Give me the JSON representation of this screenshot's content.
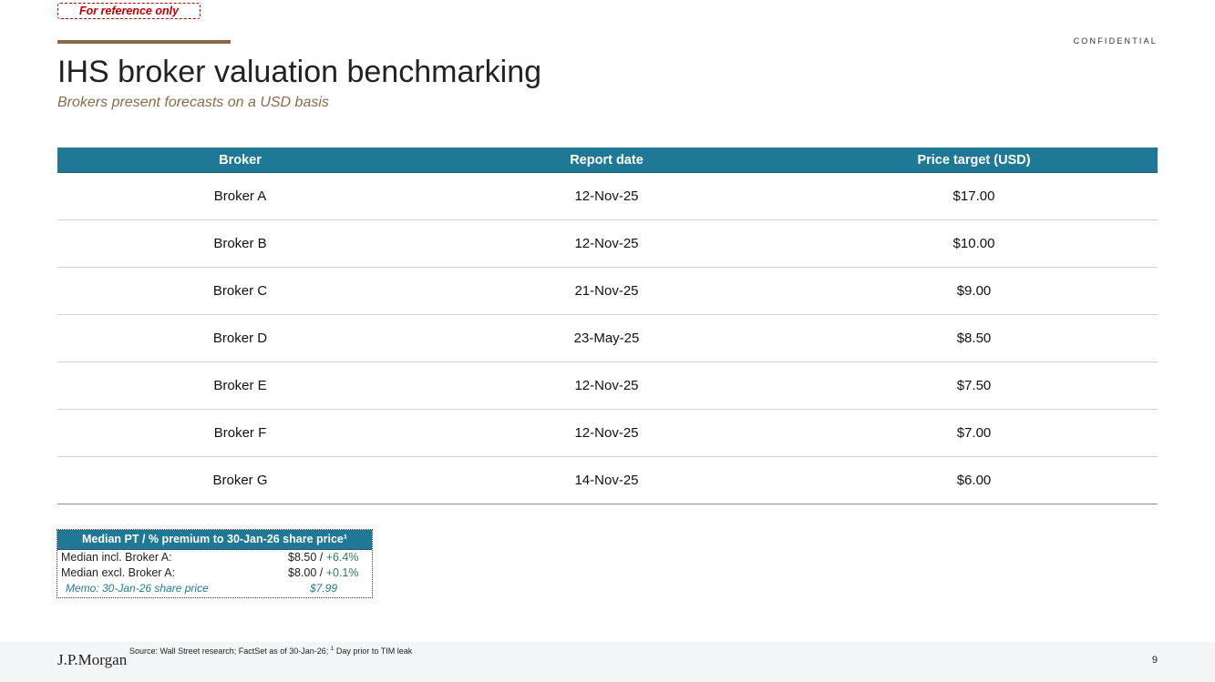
{
  "stamp": "For reference only",
  "confidential": "CONFIDENTIAL",
  "title": "IHS broker valuation benchmarking",
  "subtitle": "Brokers present forecasts on a USD basis",
  "table": {
    "headers": [
      "Broker",
      "Report date",
      "Price target (USD)"
    ],
    "rows": [
      [
        "Broker A",
        "12-Nov-25",
        "$17.00"
      ],
      [
        "Broker B",
        "12-Nov-25",
        "$10.00"
      ],
      [
        "Broker C",
        "21-Nov-25",
        "$9.00"
      ],
      [
        "Broker D",
        "23-May-25",
        "$8.50"
      ],
      [
        "Broker E",
        "12-Nov-25",
        "$7.50"
      ],
      [
        "Broker F",
        "12-Nov-25",
        "$7.00"
      ],
      [
        "Broker G",
        "14-Nov-25",
        "$6.00"
      ]
    ]
  },
  "median": {
    "header": "Median PT / % premium to 30-Jan-26 share price¹",
    "incl_label": "Median incl. Broker A:",
    "incl_value": "$8.50",
    "incl_sep": " / ",
    "incl_premium": "+6.4%",
    "excl_label": "Median excl. Broker A:",
    "excl_value": "$8.00",
    "excl_sep": " / ",
    "excl_premium": "+0.1%",
    "memo_label": "Memo: 30-Jan-26 share price",
    "memo_value": "$7.99"
  },
  "footer": {
    "source_prefix": "Source: Wall Street research; FactSet as of 30-Jan-26;",
    "footnote_mark": "1",
    "source_suffix": "Day prior to TIM leak",
    "logo": "J.P.Morgan",
    "page_number": "9"
  },
  "colors": {
    "header_blue": "#1f7896",
    "accent_brown": "#8c6a45",
    "stamp_red": "#c00000",
    "premium_green": "#2e7d5b"
  }
}
